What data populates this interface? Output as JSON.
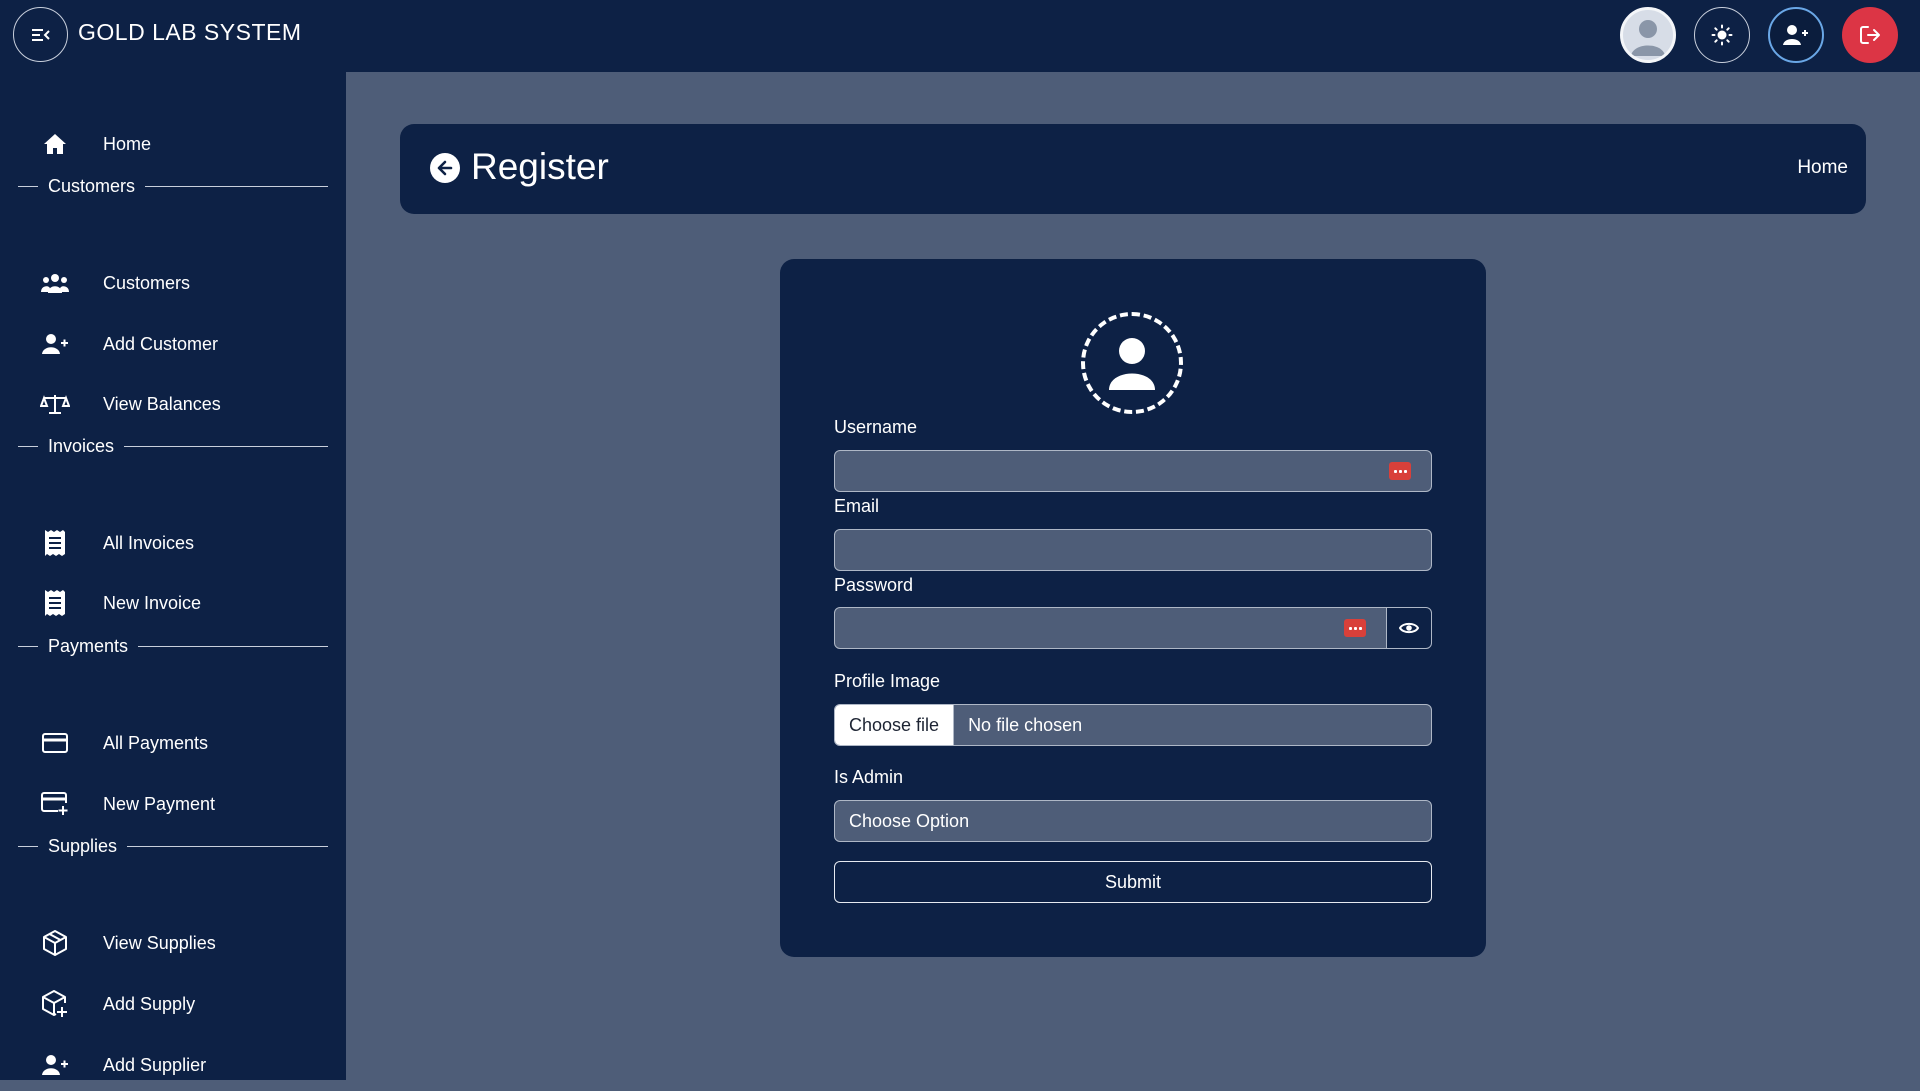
{
  "app": {
    "title": "GOLD LAB SYSTEM"
  },
  "topbar": {
    "buttons": [
      {
        "icon": "user-avatar-icon"
      },
      {
        "icon": "sun-icon"
      },
      {
        "icon": "add-user-icon"
      },
      {
        "icon": "logout-icon"
      }
    ]
  },
  "sidebar": {
    "home": {
      "label": "Home",
      "icon": "home-icon"
    },
    "sections": {
      "customers": "Customers",
      "invoices": "Invoices",
      "payments": "Payments",
      "supplies": "Supplies"
    },
    "items": {
      "customers": {
        "label": "Customers",
        "icon": "users-icon"
      },
      "add_customer": {
        "label": "Add Customer",
        "icon": "user-plus-icon"
      },
      "view_balances": {
        "label": "View Balances",
        "icon": "scale-icon"
      },
      "all_invoices": {
        "label": "All Invoices",
        "icon": "receipt-icon"
      },
      "new_invoice": {
        "label": "New Invoice",
        "icon": "receipt-icon"
      },
      "all_payments": {
        "label": "All Payments",
        "icon": "credit-card-icon"
      },
      "new_payment": {
        "label": "New Payment",
        "icon": "credit-card-plus-icon"
      },
      "view_supplies": {
        "label": "View Supplies",
        "icon": "box-icon"
      },
      "add_supply": {
        "label": "Add Supply",
        "icon": "box-plus-icon"
      },
      "add_supplier": {
        "label": "Add Supplier",
        "icon": "user-plus-icon"
      }
    }
  },
  "header": {
    "title": "Register",
    "breadcrumb": "Home"
  },
  "form": {
    "username": {
      "label": "Username",
      "value": ""
    },
    "email": {
      "label": "Email",
      "value": ""
    },
    "password": {
      "label": "Password",
      "value": ""
    },
    "profile_image": {
      "label": "Profile Image",
      "button": "Choose file",
      "status": "No file chosen"
    },
    "is_admin": {
      "label": "Is Admin",
      "selected": "Choose Option"
    },
    "submit": "Submit"
  },
  "colors": {
    "navy": "#0d2145",
    "page_bg": "#4e5d78",
    "danger": "#dc3545",
    "accent_blue": "#6aa7e6"
  }
}
